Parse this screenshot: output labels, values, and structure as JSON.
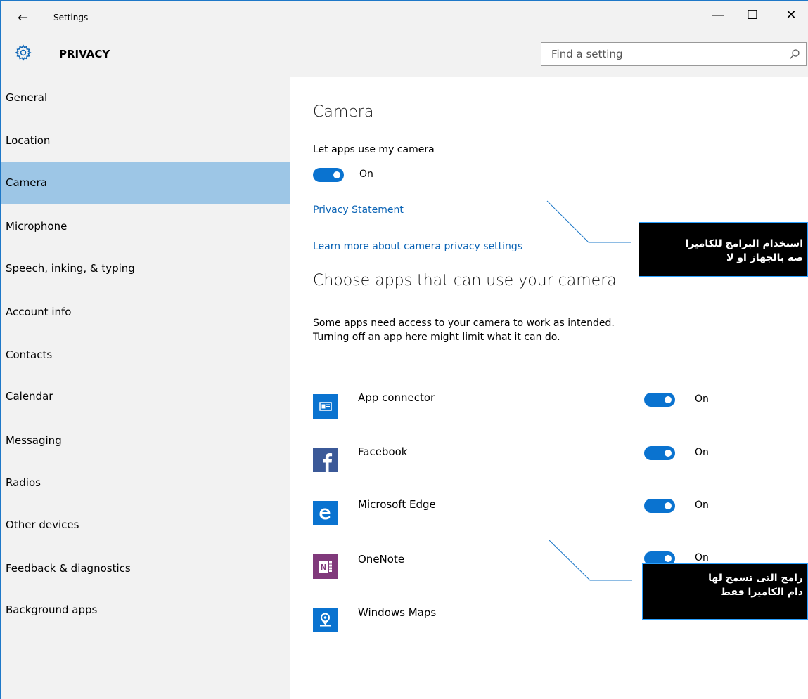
{
  "window": {
    "title": "Settings",
    "back_icon": "←",
    "minimize_icon": "—",
    "maximize_icon": "☐",
    "close_icon": "✕"
  },
  "header": {
    "section_title": "PRIVACY",
    "search_placeholder": "Find a setting"
  },
  "sidebar": {
    "items": [
      {
        "label": "General"
      },
      {
        "label": "Location"
      },
      {
        "label": "Camera"
      },
      {
        "label": "Microphone"
      },
      {
        "label": "Speech, inking, & typing"
      },
      {
        "label": "Account info"
      },
      {
        "label": "Contacts"
      },
      {
        "label": "Calendar"
      },
      {
        "label": "Messaging"
      },
      {
        "label": "Radios"
      },
      {
        "label": "Other devices"
      },
      {
        "label": "Feedback & diagnostics"
      },
      {
        "label": "Background apps"
      }
    ],
    "active_item": "Camera"
  },
  "main": {
    "title": "Camera",
    "toggle_label": "Let apps use my camera",
    "toggle_state": "On",
    "privacy_link": "Privacy Statement",
    "learn_more_link": "Learn more about camera privacy settings",
    "apps_heading": "Choose apps that can use your camera",
    "apps_description_1": "Some apps need access to your camera to work as intended.",
    "apps_description_2": "Turning off an app here might limit what it can do.",
    "apps": [
      {
        "name": "App connector",
        "state": "On",
        "icon": "app-connector-icon",
        "color": "#0a73d0"
      },
      {
        "name": "Facebook",
        "state": "On",
        "icon": "facebook-icon",
        "color": "#3b5998"
      },
      {
        "name": "Microsoft Edge",
        "state": "On",
        "icon": "edge-icon",
        "color": "#0a73d0"
      },
      {
        "name": "OneNote",
        "state": "On",
        "icon": "onenote-icon",
        "color": "#80397b"
      },
      {
        "name": "Windows Maps",
        "state": "",
        "icon": "maps-icon",
        "color": "#0a73d0"
      }
    ]
  },
  "annotations": [
    {
      "line1": "استخدام البرامج للكاميرا",
      "line2": "صة بالجهاز او لا"
    },
    {
      "line1": "رامج التى تسمح لها",
      "line2": "دام الكاميرا فقط"
    }
  ],
  "colors": {
    "accent": "#0a73d0",
    "link": "#0a63b5",
    "sidebar_active": "#9dc6e6",
    "callout_border": "#2aa0ff"
  }
}
